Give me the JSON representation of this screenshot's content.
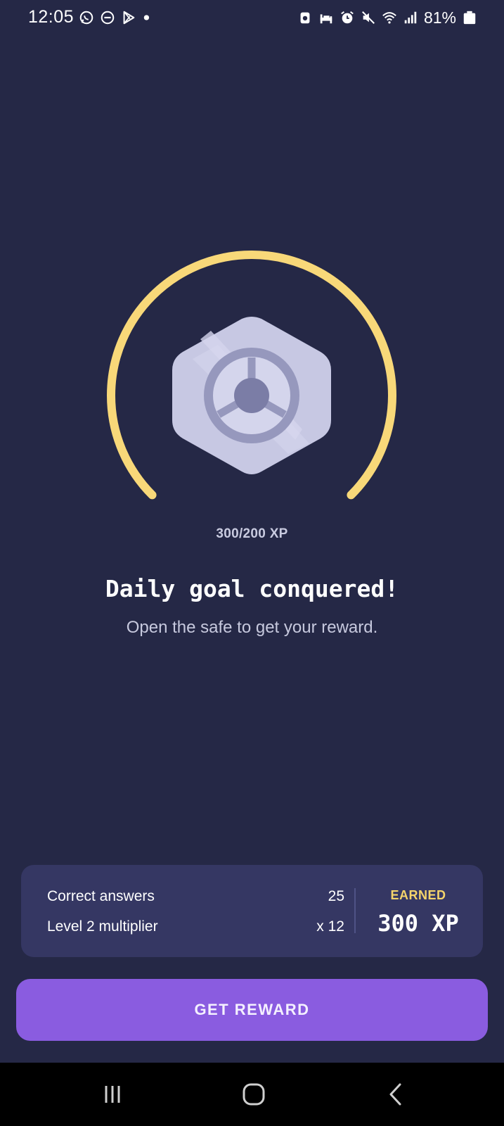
{
  "status_bar": {
    "time": "12:05",
    "battery": "81%",
    "left_icons": [
      "whatsapp-icon",
      "do-not-disturb-icon",
      "play-store-icon",
      "dot-icon"
    ],
    "right_icons": [
      "backup-icon",
      "bed-icon",
      "alarm-icon",
      "mute-icon",
      "wifi-icon",
      "signal-icon",
      "battery-icon"
    ]
  },
  "goal": {
    "xp_progress": "300/200 XP",
    "progress_fraction": 1.0,
    "ring_color": "#f8d879",
    "badge_icon": "safe-dial-icon",
    "title": "Daily goal conquered!",
    "subtitle": "Open the safe to get your reward."
  },
  "summary": {
    "rows": [
      {
        "label": "Correct answers",
        "value": "25"
      },
      {
        "label": "Level 2 multiplier",
        "value": "x 12"
      }
    ],
    "earned_label": "EARNED",
    "earned_value": "300 XP",
    "earned_color": "#f5d46b"
  },
  "cta": {
    "label": "GET REWARD",
    "color": "#8a5ce0"
  },
  "nav": {
    "buttons": [
      "recent-apps-icon",
      "home-icon",
      "back-icon"
    ]
  }
}
